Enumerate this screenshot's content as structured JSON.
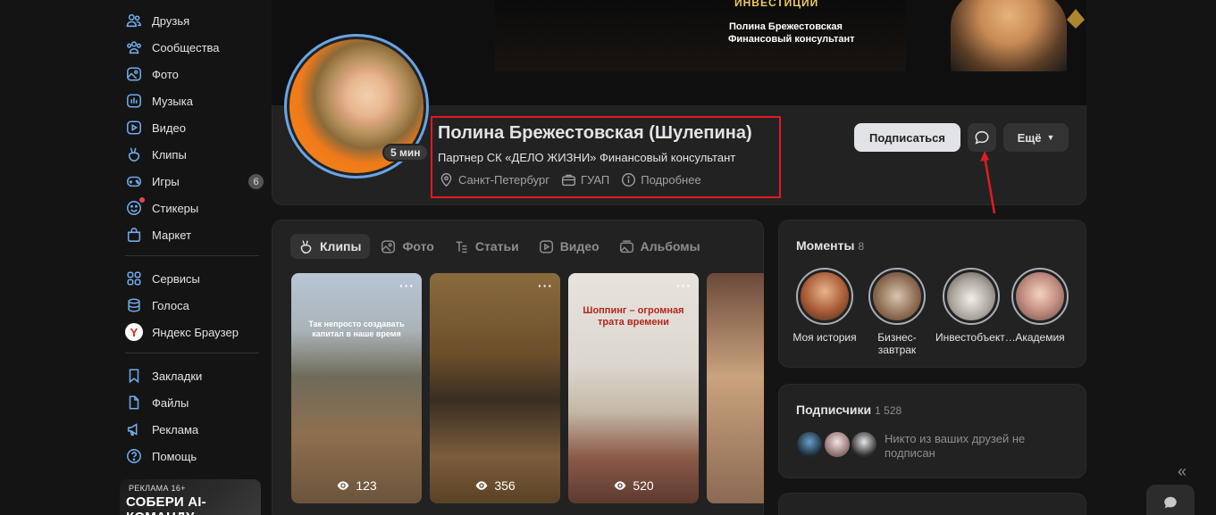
{
  "sidebar": {
    "items": [
      {
        "label": "Друзья",
        "icon": "friends-icon"
      },
      {
        "label": "Сообщества",
        "icon": "communities-icon"
      },
      {
        "label": "Фото",
        "icon": "photo-icon"
      },
      {
        "label": "Музыка",
        "icon": "music-icon"
      },
      {
        "label": "Видео",
        "icon": "video-icon"
      },
      {
        "label": "Клипы",
        "icon": "clips-icon"
      },
      {
        "label": "Игры",
        "icon": "games-icon",
        "badge": "6"
      },
      {
        "label": "Стикеры",
        "icon": "stickers-icon"
      },
      {
        "label": "Маркет",
        "icon": "market-icon"
      },
      {
        "label": "Сервисы",
        "icon": "services-icon"
      },
      {
        "label": "Голоса",
        "icon": "votes-icon"
      },
      {
        "label": "Яндекс Браузер",
        "icon": "yandex-browser-icon"
      },
      {
        "label": "Закладки",
        "icon": "bookmarks-icon"
      },
      {
        "label": "Файлы",
        "icon": "files-icon"
      },
      {
        "label": "Реклама",
        "icon": "ads-icon"
      },
      {
        "label": "Помощь",
        "icon": "help-icon"
      }
    ],
    "ad": {
      "tag": "РЕКЛАМА 16+",
      "text": "СОБЕРИ AI-КОМАНДУ"
    }
  },
  "cover": {
    "headline": "ИНВЕСТИЦИИ",
    "line1": "Полина Брежестовская",
    "line2": "Финансовый консультант"
  },
  "profile": {
    "name": "Полина Брежестовская (Шулепина)",
    "status": "Партнер СК «ДЕЛО ЖИЗНИ» Финансовый консультант",
    "city": "Санкт-Петербург",
    "education": "ГУАП",
    "more_info": "Подробнее",
    "online": "5 мин",
    "subscribe_label": "Подписаться",
    "more_label": "Ещё"
  },
  "tabs": [
    "Клипы",
    "Фото",
    "Статьи",
    "Видео",
    "Альбомы"
  ],
  "clips": [
    {
      "caption": "Так непросто создавать капитал в наше время",
      "views": "123"
    },
    {
      "caption": "",
      "views": "356"
    },
    {
      "caption": "Шоппинг – огромная трата времени",
      "views": "520"
    },
    {
      "caption": "",
      "views": ""
    }
  ],
  "moments": {
    "title": "Моменты",
    "count": "8",
    "items": [
      "Моя история",
      "Бизнес-завтрак",
      "Инвестобъект…",
      "Академия"
    ]
  },
  "subscribers": {
    "title": "Подписчики",
    "count": "1 528",
    "note": "Никто из ваших друзей не подписан"
  },
  "colors": {
    "accent": "#71aaeb",
    "highlight": "#e01b24",
    "background": "#141414",
    "card": "#222222"
  }
}
